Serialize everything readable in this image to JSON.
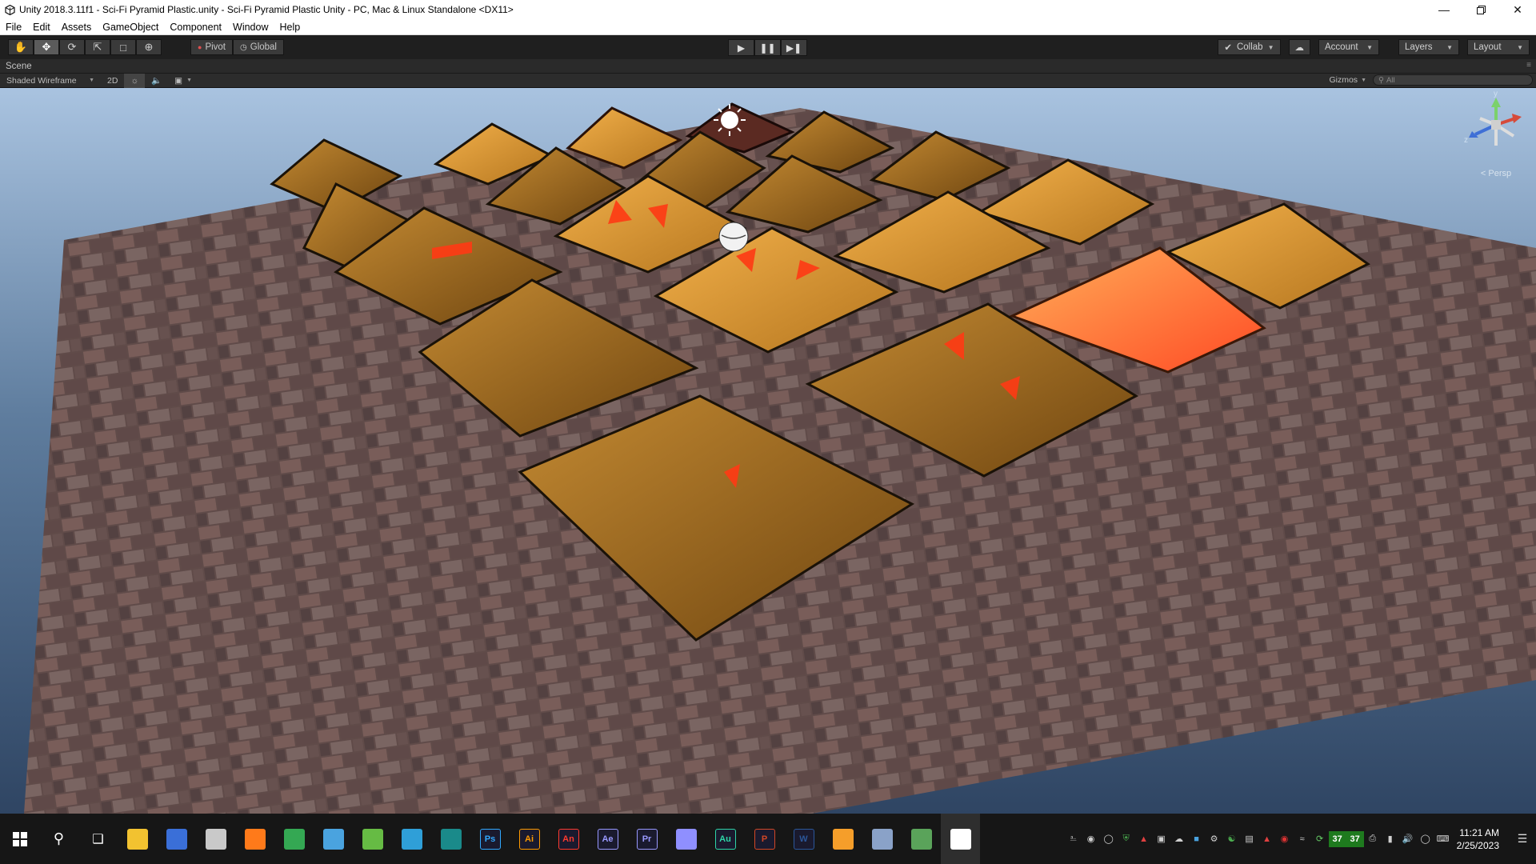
{
  "window": {
    "title": "Unity 2018.3.11f1 - Sci-Fi Pyramid Plastic.unity - Sci-Fi Pyramid Plastic Unity - PC, Mac & Linux Standalone <DX11>",
    "controls": [
      "minimize-icon",
      "restore-icon",
      "close-icon"
    ]
  },
  "menu": {
    "items": [
      "File",
      "Edit",
      "Assets",
      "GameObject",
      "Component",
      "Window",
      "Help"
    ]
  },
  "toolbar": {
    "tools": [
      "hand-icon",
      "move-icon",
      "rotate-icon",
      "scale-icon",
      "rect-icon",
      "transform-icon"
    ],
    "pivot_label": "Pivot",
    "global_label": "Global",
    "collab_label": "Collab",
    "account_label": "Account",
    "layers_label": "Layers",
    "layout_label": "Layout"
  },
  "scene": {
    "tab_label": "Scene",
    "shading_mode": "Shaded Wireframe",
    "mode_2d": "2D",
    "gizmos_label": "Gizmos",
    "search_placeholder": "All",
    "persp_label": "Persp"
  },
  "gizmo": {
    "y_label": "y",
    "z_label": "z"
  },
  "taskbar": {
    "apps": [
      {
        "name": "file-explorer",
        "label": "",
        "color": "#f2c230"
      },
      {
        "name": "app-blue",
        "label": "",
        "color": "#3a6fd8"
      },
      {
        "name": "app-paint",
        "label": "",
        "color": "#c9c9c9"
      },
      {
        "name": "firefox",
        "label": "",
        "color": "#ff7a1a"
      },
      {
        "name": "chrome",
        "label": "",
        "color": "#34a853"
      },
      {
        "name": "search-app",
        "label": "",
        "color": "#4aa3df"
      },
      {
        "name": "globe-app",
        "label": "",
        "color": "#66bb44"
      },
      {
        "name": "globe-app-2",
        "label": "",
        "color": "#2f9fd8"
      },
      {
        "name": "maya",
        "label": "",
        "color": "#1a8a8a"
      },
      {
        "name": "photoshop",
        "label": "Ps",
        "color": "#31a8ff"
      },
      {
        "name": "illustrator",
        "label": "Ai",
        "color": "#ff9a00"
      },
      {
        "name": "animate",
        "label": "An",
        "color": "#ff3a2f"
      },
      {
        "name": "after-effects",
        "label": "Ae",
        "color": "#9999ff"
      },
      {
        "name": "premiere",
        "label": "Pr",
        "color": "#9999ff"
      },
      {
        "name": "media-encoder",
        "label": "",
        "color": "#8f8fff"
      },
      {
        "name": "audition",
        "label": "Au",
        "color": "#2ed5a8"
      },
      {
        "name": "powerpoint",
        "label": "P",
        "color": "#d24726"
      },
      {
        "name": "word",
        "label": "W",
        "color": "#2b579a"
      },
      {
        "name": "sublime",
        "label": "",
        "color": "#f59e2a"
      },
      {
        "name": "notepad-app",
        "label": "",
        "color": "#8aa2c8"
      },
      {
        "name": "package-app",
        "label": "",
        "color": "#5aa35a"
      },
      {
        "name": "unity",
        "label": "",
        "color": "#ffffff"
      }
    ],
    "tray_counts": [
      "37",
      "37"
    ],
    "time": "11:21 AM",
    "date": "2/25/2023"
  }
}
